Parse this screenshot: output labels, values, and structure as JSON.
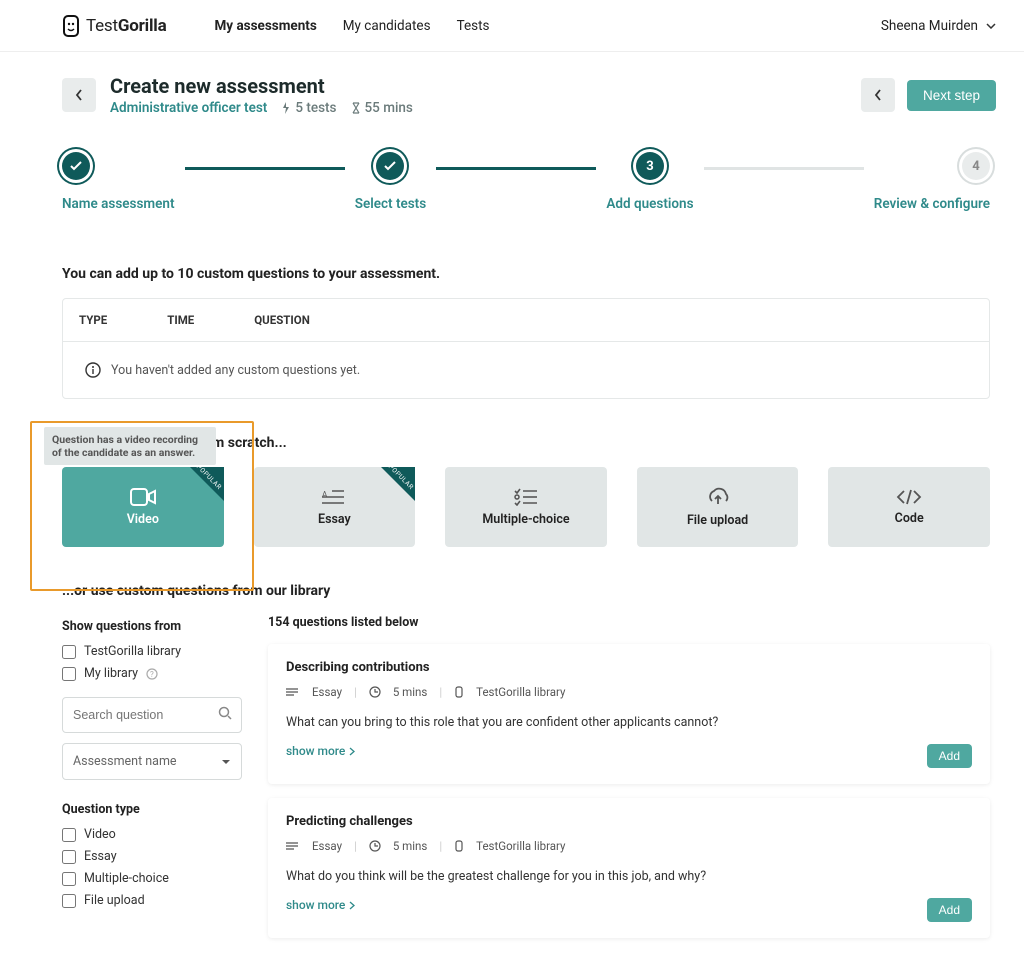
{
  "brand": {
    "name_a": "Test",
    "name_b": "Gorilla"
  },
  "nav": {
    "assessments": "My assessments",
    "candidates": "My candidates",
    "tests": "Tests"
  },
  "user": {
    "name": "Sheena Muirden"
  },
  "header": {
    "title": "Create new assessment",
    "assessment_name": "Administrative officer test",
    "tests_count": "5 tests",
    "duration": "55 mins",
    "next_label": "Next step"
  },
  "steps": {
    "s1": "Name assessment",
    "s2": "Select tests",
    "s3": "Add questions",
    "s4": "Review & configure",
    "n3": "3",
    "n4": "4"
  },
  "custom_intro": "You can add up to 10 custom questions to your assessment.",
  "table": {
    "col_type": "TYPE",
    "col_time": "TIME",
    "col_question": "QUESTION",
    "empty": "You haven't added any custom questions yet."
  },
  "scratch_heading": "m scratch...",
  "tooltip_text": "Question has a video recording of the candidate as an answer.",
  "cards": {
    "video": "Video",
    "essay": "Essay",
    "multiple": "Multiple-choice",
    "file": "File upload",
    "code": "Code",
    "popular": "POPULAR"
  },
  "library_heading": "...or use custom questions from our library",
  "filters": {
    "show_from": "Show questions from",
    "tg_library": "TestGorilla library",
    "my_library": "My library",
    "search_placeholder": "Search question",
    "assessment_dropdown": "Assessment name",
    "qtype": "Question type",
    "t_video": "Video",
    "t_essay": "Essay",
    "t_multi": "Multiple-choice",
    "t_file": "File upload"
  },
  "results": {
    "count": "154 questions listed below",
    "show_more": "show more",
    "add": "Add",
    "q1": {
      "title": "Describing contributions",
      "type": "Essay",
      "time": "5 mins",
      "source": "TestGorilla library",
      "body": "What can you bring to this role that you are confident other applicants cannot?"
    },
    "q2": {
      "title": "Predicting challenges",
      "type": "Essay",
      "time": "5 mins",
      "source": "TestGorilla library",
      "body": "What do you think will be the greatest challenge for you in this job, and why?"
    }
  }
}
